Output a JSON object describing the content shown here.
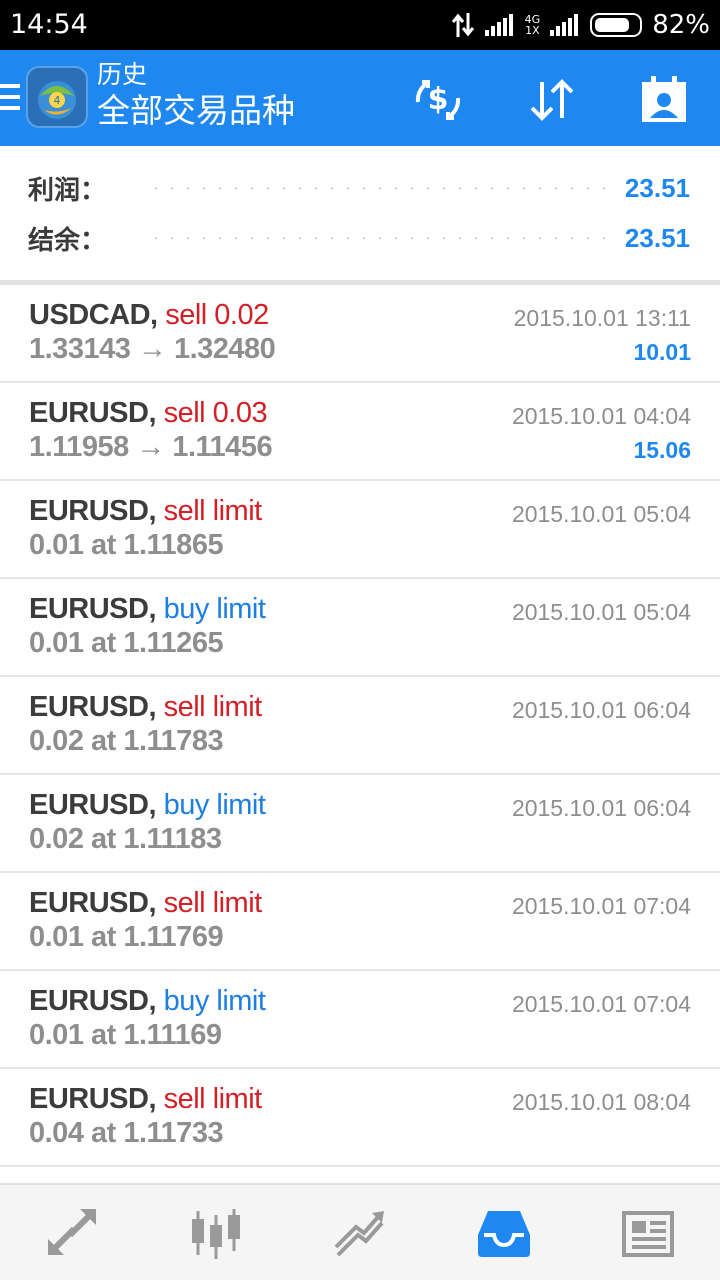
{
  "status_bar": {
    "time": "14:54",
    "network_top": "4G",
    "network_bottom": "1X",
    "battery_percent": "82%",
    "battery_level": 0.82
  },
  "app_bar": {
    "title": "历史",
    "subtitle": "全部交易品种",
    "actions": [
      "currency-exchange-icon",
      "sort-icon",
      "calendar-contact-icon"
    ]
  },
  "summary": {
    "profit_label": "利润：",
    "profit_value": "23.51",
    "balance_label": "结余：",
    "balance_value": "23.51"
  },
  "deals": [
    {
      "symbol": "USDCAD,",
      "action": "sell 0.02",
      "action_color": "red",
      "detail": "1.33143 → 1.32480",
      "datetime": "2015.10.01 13:11",
      "profit": "10.01"
    },
    {
      "symbol": "EURUSD,",
      "action": "sell 0.03",
      "action_color": "red",
      "detail": "1.11958 → 1.11456",
      "datetime": "2015.10.01 04:04",
      "profit": "15.06"
    },
    {
      "symbol": "EURUSD,",
      "action": "sell limit",
      "action_color": "red",
      "detail": "0.01 at 1.11865",
      "datetime": "2015.10.01 05:04",
      "profit": ""
    },
    {
      "symbol": "EURUSD,",
      "action": "buy limit",
      "action_color": "blue",
      "detail": "0.01 at 1.11265",
      "datetime": "2015.10.01 05:04",
      "profit": ""
    },
    {
      "symbol": "EURUSD,",
      "action": "sell limit",
      "action_color": "red",
      "detail": "0.02 at 1.11783",
      "datetime": "2015.10.01 06:04",
      "profit": ""
    },
    {
      "symbol": "EURUSD,",
      "action": "buy limit",
      "action_color": "blue",
      "detail": "0.02 at 1.11183",
      "datetime": "2015.10.01 06:04",
      "profit": ""
    },
    {
      "symbol": "EURUSD,",
      "action": "sell limit",
      "action_color": "red",
      "detail": "0.01 at 1.11769",
      "datetime": "2015.10.01 07:04",
      "profit": ""
    },
    {
      "symbol": "EURUSD,",
      "action": "buy limit",
      "action_color": "blue",
      "detail": "0.01 at 1.11169",
      "datetime": "2015.10.01 07:04",
      "profit": ""
    },
    {
      "symbol": "EURUSD,",
      "action": "sell limit",
      "action_color": "red",
      "detail": "0.04 at 1.11733",
      "datetime": "2015.10.01 08:04",
      "profit": ""
    }
  ],
  "bottom_nav": {
    "items": [
      "quotes-icon",
      "chart-icon",
      "trade-icon",
      "history-icon",
      "news-icon"
    ],
    "active_index": 3
  },
  "colors": {
    "accent": "#1e88f0",
    "sell": "#d32026",
    "buy": "#1e7fe0",
    "nav_inactive": "#9a9a9a"
  }
}
